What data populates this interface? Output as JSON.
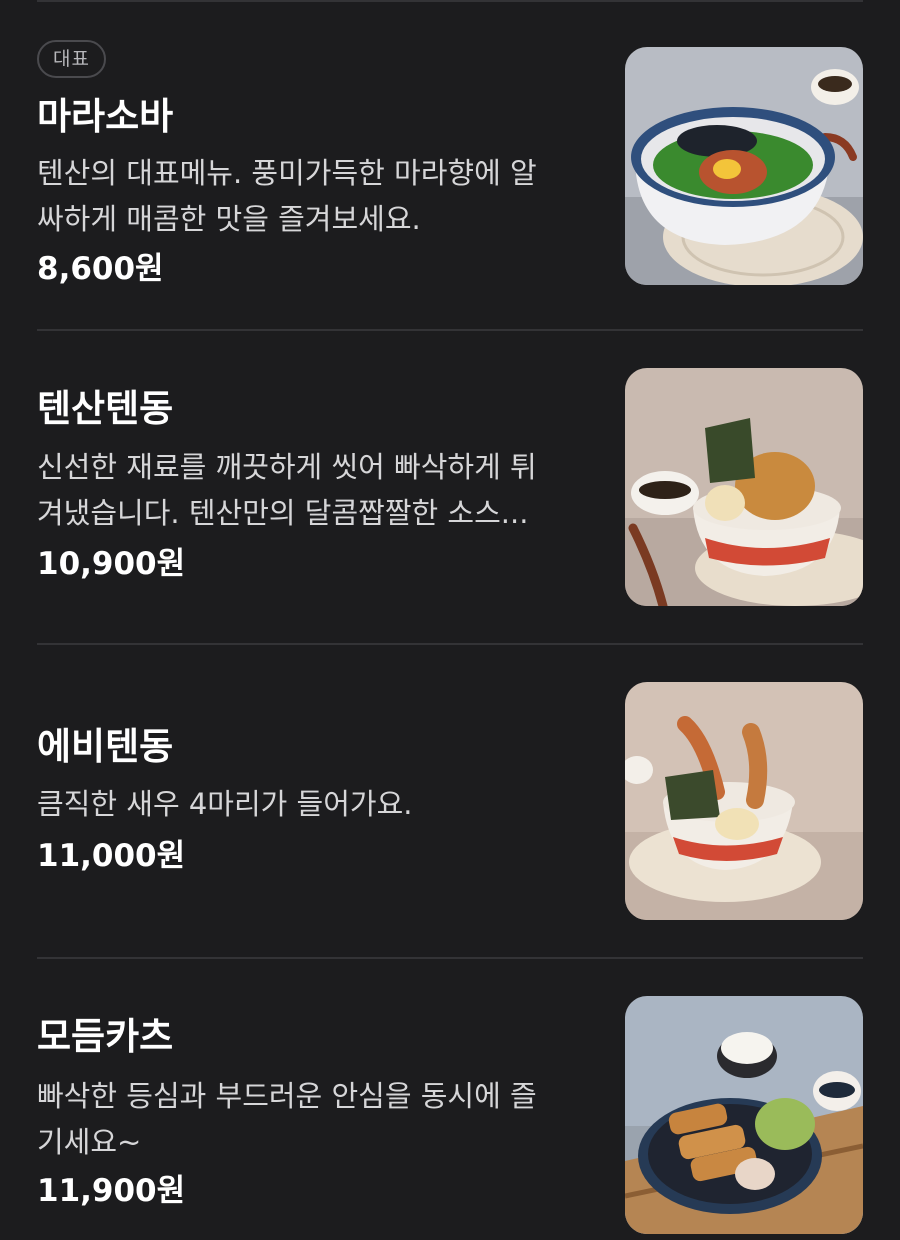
{
  "menu_items": [
    {
      "badge": "대표",
      "name": "마라소바",
      "description_lines": [
        "텐산의 대표메뉴. 풍미가득한 마라향에 알",
        "싸하게 매콤한 맛을 즐겨보세요."
      ],
      "price": "8,600원"
    },
    {
      "name": "텐산텐동",
      "description_lines": [
        "신선한 재료를 깨끗하게 씻어 빠삭하게 튀",
        "겨냈습니다. 텐산만의 달콤짭짤한 소스..."
      ],
      "price": "10,900원"
    },
    {
      "name": "에비텐동",
      "description_lines": [
        "큼직한 새우 4마리가 들어가요."
      ],
      "price": "11,000원"
    },
    {
      "name": "모듬카츠",
      "description_lines": [
        "빠삭한 등심과 부드러운 안심을 동시에 즐",
        "기세요~"
      ],
      "price": "11,900원"
    }
  ]
}
